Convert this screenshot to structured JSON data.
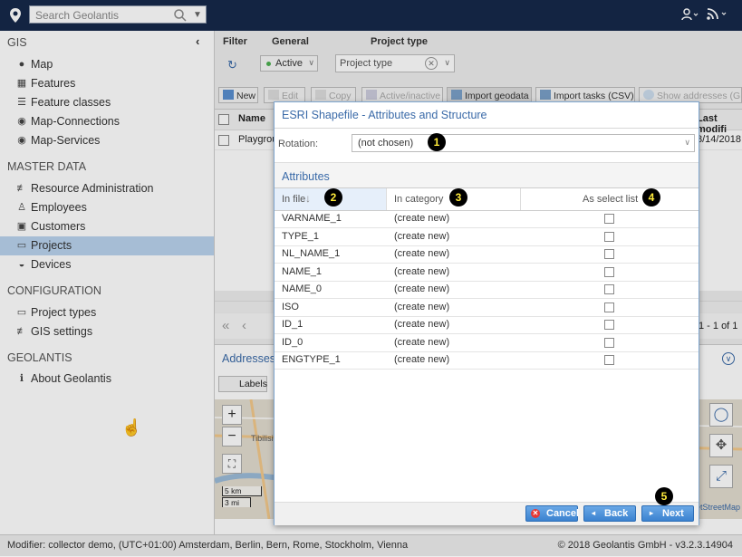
{
  "topbar": {
    "search_placeholder": "Search Geolantis"
  },
  "sidebar": {
    "sections": [
      {
        "title": "GIS",
        "items": [
          {
            "label": "Map",
            "icon": "map-pin-icon"
          },
          {
            "label": "Features",
            "icon": "features-icon"
          },
          {
            "label": "Feature classes",
            "icon": "list-icon"
          },
          {
            "label": "Map-Connections",
            "icon": "globe-icon"
          },
          {
            "label": "Map-Services",
            "icon": "globe-icon"
          }
        ]
      },
      {
        "title": "MASTER DATA",
        "items": [
          {
            "label": "Resource Administration",
            "icon": "sliders-icon"
          },
          {
            "label": "Employees",
            "icon": "user-icon"
          },
          {
            "label": "Customers",
            "icon": "contact-icon"
          },
          {
            "label": "Projects",
            "icon": "folder-icon",
            "active": true
          },
          {
            "label": "Devices",
            "icon": "wifi-icon"
          }
        ]
      },
      {
        "title": "CONFIGURATION",
        "items": [
          {
            "label": "Project types",
            "icon": "folder-icon"
          },
          {
            "label": "GIS settings",
            "icon": "sliders-icon"
          }
        ]
      },
      {
        "title": "GEOLANTIS",
        "items": [
          {
            "label": "About Geolantis",
            "icon": "info-icon"
          }
        ]
      }
    ]
  },
  "filter": {
    "filter_label": "Filter",
    "general_label": "General",
    "project_type_label": "Project type",
    "active_value": "Active",
    "project_type_placeholder": "Project type"
  },
  "toolbar": {
    "buttons": [
      "New",
      "Edit",
      "Copy",
      "Active/inactive",
      "Import geodata",
      "Import tasks (CSV)",
      "Show addresses (GPS)"
    ]
  },
  "grid": {
    "col_name": "Name",
    "col_last": "Last modifi",
    "row_name": "Playgrou",
    "row_date": "8/14/2018",
    "pager_text": "1 - 1 of 1"
  },
  "addresses": {
    "title": "Addresses",
    "labels_button": "Labels",
    "scale_km": "5 km",
    "scale_mi": "3 mi",
    "map_city": "Tibilisi",
    "attribution": "etStreetMap"
  },
  "status": {
    "left": "Modifier: collector demo, (UTC+01:00) Amsterdam, Berlin, Bern, Rome, Stockholm, Vienna",
    "right": "© 2018 Geolantis GmbH - v3.2.3.14904"
  },
  "dialog": {
    "title": "ESRI Shapefile - Attributes and Structure",
    "rotation_label": "Rotation:",
    "rotation_value": "(not chosen)",
    "attributes_title": "Attributes",
    "col_infile": "In file",
    "col_incategory": "In category",
    "col_selectlist": "As select list",
    "rows": [
      {
        "file": "VARNAME_1",
        "category": "(create new)"
      },
      {
        "file": "TYPE_1",
        "category": "(create new)"
      },
      {
        "file": "NL_NAME_1",
        "category": "(create new)"
      },
      {
        "file": "NAME_1",
        "category": "(create new)"
      },
      {
        "file": "NAME_0",
        "category": "(create new)"
      },
      {
        "file": "ISO",
        "category": "(create new)"
      },
      {
        "file": "ID_1",
        "category": "(create new)"
      },
      {
        "file": "ID_0",
        "category": "(create new)"
      },
      {
        "file": "ENGTYPE_1",
        "category": "(create new)"
      }
    ],
    "cancel_label": "Cancel",
    "back_label": "Back",
    "next_label": "Next"
  },
  "callouts": [
    "1",
    "2",
    "3",
    "4",
    "5"
  ]
}
